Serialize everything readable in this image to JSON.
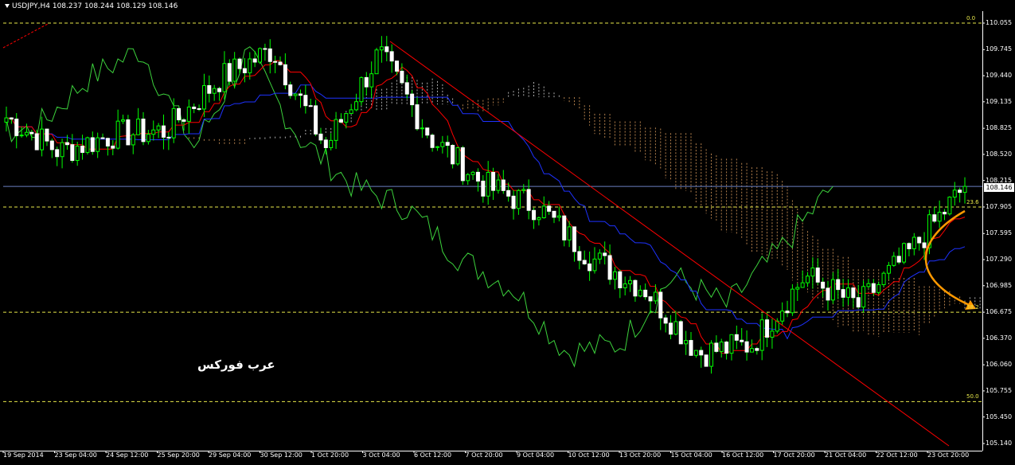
{
  "header": {
    "symbol": "USDJPY,H4",
    "open": "108.237",
    "high": "108.244",
    "low": "108.129",
    "close": "108.146"
  },
  "watermark": "عرب فوركس",
  "price_axis": [
    "110.055",
    "109.745",
    "109.440",
    "109.135",
    "108.825",
    "108.520",
    "108.215",
    "107.905",
    "107.595",
    "107.290",
    "106.985",
    "106.675",
    "106.370",
    "106.060",
    "105.755",
    "105.450",
    "105.140"
  ],
  "current_price": "108.146",
  "time_axis": [
    "19 Sep 2014",
    "23 Sep 04:00",
    "24 Sep 12:00",
    "25 Sep 20:00",
    "29 Sep 04:00",
    "30 Sep 12:00",
    "1 Oct 20:00",
    "3 Oct 04:00",
    "6 Oct 12:00",
    "7 Oct 20:00",
    "9 Oct 04:00",
    "10 Oct 12:00",
    "13 Oct 20:00",
    "15 Oct 04:00",
    "16 Oct 12:00",
    "17 Oct 20:00",
    "21 Oct 04:00",
    "22 Oct 12:00",
    "23 Oct 20:00"
  ],
  "fibonacci": [
    {
      "label": "0.0",
      "price": 110.055
    },
    {
      "label": "23.6",
      "price": 107.905
    },
    {
      "label": "38.2",
      "price": 106.675
    },
    {
      "label": "50.0",
      "price": 105.63
    }
  ],
  "colors": {
    "background": "#000000",
    "bull_candle": "#00ff00",
    "bear_candle": "#ffffff",
    "chikou": "#3cd23c",
    "tenkan": "#ff0000",
    "kijun": "#1e32ff",
    "fib": "#e8e84a",
    "trendline": "#ff0000",
    "forecast_arrow": "#ff9900",
    "bid_line": "#6a7fbf"
  },
  "chart_data": {
    "type": "candlestick",
    "symbol": "USDJPY",
    "timeframe": "H4",
    "ylim": [
      105.14,
      110.055
    ],
    "anchor_points": [
      {
        "time": "19 Sep 2014",
        "price": 108.95
      },
      {
        "time": "23 Sep 04:00",
        "price": 108.55
      },
      {
        "time": "24 Sep 12:00",
        "price": 108.75
      },
      {
        "time": "25 Sep 20:00",
        "price": 108.8
      },
      {
        "time": "29 Sep 04:00",
        "price": 109.4
      },
      {
        "time": "30 Sep 12:00",
        "price": 109.75
      },
      {
        "time": "1 Oct 20:00",
        "price": 108.6
      },
      {
        "time": "3 Oct 04:00",
        "price": 109.7
      },
      {
        "time": "6 Oct 12:00",
        "price": 108.7
      },
      {
        "time": "7 Oct 20:00",
        "price": 108.15
      },
      {
        "time": "9 Oct 04:00",
        "price": 107.9
      },
      {
        "time": "10 Oct 12:00",
        "price": 107.3
      },
      {
        "time": "13 Oct 20:00",
        "price": 106.95
      },
      {
        "time": "15 Oct 04:00",
        "price": 106.2
      },
      {
        "time": "16 Oct 12:00",
        "price": 106.3
      },
      {
        "time": "17 Oct 20:00",
        "price": 107.1
      },
      {
        "time": "21 Oct 04:00",
        "price": 106.75
      },
      {
        "time": "22 Oct 12:00",
        "price": 107.4
      },
      {
        "time": "23 Oct 20:00",
        "price": 108.146
      }
    ],
    "last_close": 108.146
  }
}
